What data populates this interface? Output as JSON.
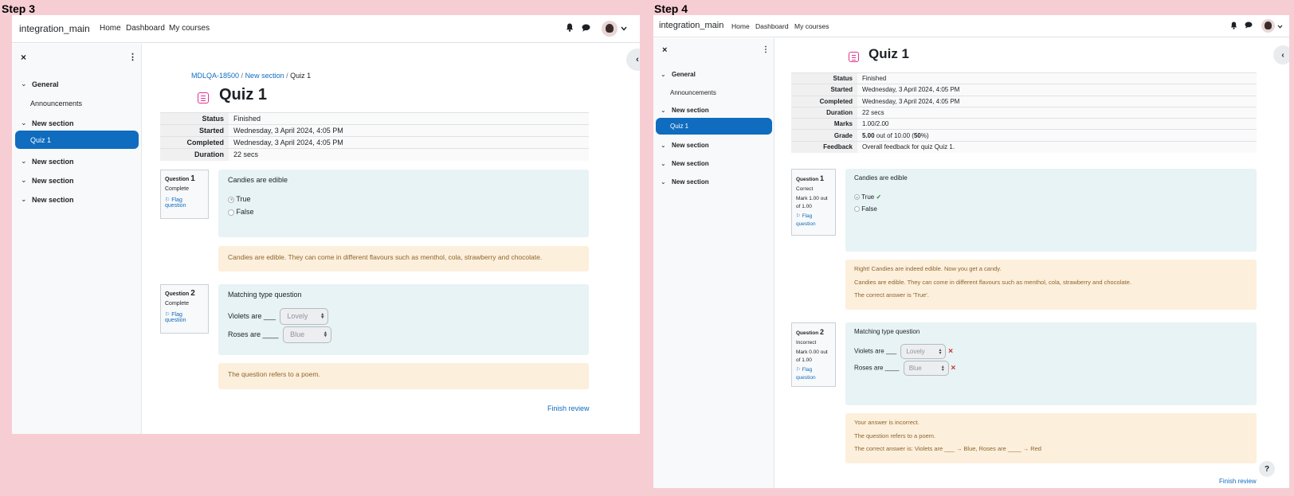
{
  "step3": {
    "label": "Step 3",
    "site_name": "integration_main",
    "nav": [
      "Home",
      "Dashboard",
      "My courses"
    ],
    "drawer": {
      "close": "×",
      "menu": "⋮",
      "sections": [
        "General",
        "New section",
        "New section",
        "New section",
        "New section"
      ],
      "activities": {
        "announcements": "Announcements",
        "quiz": "Quiz 1"
      }
    },
    "breadcrumb": [
      "MDLQA-18500",
      "New section",
      "Quiz 1"
    ],
    "title": "Quiz 1",
    "summary": [
      {
        "k": "Status",
        "v": "Finished"
      },
      {
        "k": "Started",
        "v": "Wednesday, 3 April 2024, 4:05 PM"
      },
      {
        "k": "Completed",
        "v": "Wednesday, 3 April 2024, 4:05 PM"
      },
      {
        "k": "Duration",
        "v": "22 secs"
      }
    ],
    "q1": {
      "prefix": "Question",
      "num": "1",
      "state": "Complete",
      "flag": "Flag question",
      "text": "Candies are edible",
      "opt_true": "True",
      "opt_false": "False",
      "feedback": "Candies are edible. They can come in different flavours such as menthol, cola, strawberry and chocolate."
    },
    "q2": {
      "prefix": "Question",
      "num": "2",
      "state": "Complete",
      "flag": "Flag question",
      "text": "Matching type question",
      "stem1": "Violets are ___",
      "sel1": "Lovely",
      "stem2": "Roses are ____",
      "sel2": "Blue",
      "feedback": "The question refers to a poem."
    },
    "finish": "Finish review"
  },
  "step4": {
    "label": "Step 4",
    "site_name": "integration_main",
    "nav": [
      "Home",
      "Dashboard",
      "My courses"
    ],
    "drawer": {
      "close": "×",
      "menu": "⋮",
      "sections": [
        "General",
        "New section",
        "New section",
        "New section",
        "New section"
      ],
      "activities": {
        "announcements": "Announcements",
        "quiz": "Quiz 1"
      }
    },
    "title": "Quiz 1",
    "summary": [
      {
        "k": "Status",
        "v": "Finished"
      },
      {
        "k": "Started",
        "v": "Wednesday, 3 April 2024, 4:05 PM"
      },
      {
        "k": "Completed",
        "v": "Wednesday, 3 April 2024, 4:05 PM"
      },
      {
        "k": "Duration",
        "v": "22 secs"
      },
      {
        "k": "Marks",
        "v": "1.00/2.00"
      },
      {
        "k": "Grade",
        "v_pre": "5.00",
        "v_mid": " out of 10.00 (",
        "v_pct": "50",
        "v_post": "%)"
      },
      {
        "k": "Feedback",
        "v": "Overall feedback for quiz Quiz 1."
      }
    ],
    "q1": {
      "prefix": "Question",
      "num": "1",
      "state": "Correct",
      "mark": "Mark 1.00 out of 1.00",
      "flag": "Flag question",
      "text": "Candies are edible",
      "opt_true": "True",
      "opt_false": "False",
      "fb1": "Right! Candies are indeed edible. Now you get a candy.",
      "fb2": "Candies are edible. They can come in different flavours such as menthol, cola, strawberry and chocolate.",
      "fb3": "The correct answer is 'True'."
    },
    "q2": {
      "prefix": "Question",
      "num": "2",
      "state": "Incorrect",
      "mark": "Mark 0.00 out of 1.00",
      "flag": "Flag question",
      "text": "Matching type question",
      "stem1": "Violets are ___",
      "sel1": "Lovely",
      "stem2": "Roses are ____",
      "sel2": "Blue",
      "fb1": "Your answer is incorrect.",
      "fb2": "The question refers to a poem.",
      "fb3": "The correct answer is: Violets are ___ → Blue, Roses are ____ → Red"
    },
    "finish": "Finish review",
    "help": "?"
  },
  "colors": {
    "pink_bg": "#f7cdd4",
    "primary": "#0f6cbf",
    "question_bg": "#e7f3f5",
    "feedback_bg": "#fcefdc",
    "feedback_text": "#8e662e",
    "quiz_icon": "#e2338f"
  }
}
